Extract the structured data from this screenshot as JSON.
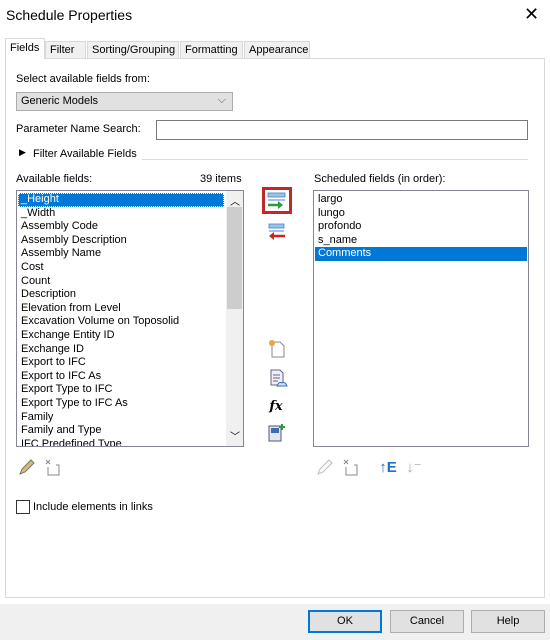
{
  "window": {
    "title": "Schedule Properties"
  },
  "tabs": [
    {
      "label": "Fields"
    },
    {
      "label": "Filter"
    },
    {
      "label": "Sorting/Grouping"
    },
    {
      "label": "Formatting"
    },
    {
      "label": "Appearance"
    }
  ],
  "fields": {
    "select_label": "Select available fields from:",
    "category": "Generic Models",
    "search_label": "Parameter Name Search:",
    "search_value": "",
    "filter_label": "Filter Available Fields",
    "available_label": "Available fields:",
    "count": "39 items",
    "available": [
      "_Height",
      "_Width",
      "Assembly Code",
      "Assembly Description",
      "Assembly Name",
      "Cost",
      "Count",
      "Description",
      "Elevation from Level",
      "Excavation Volume on Toposolid",
      "Exchange Entity ID",
      "Exchange ID",
      "Export to IFC",
      "Export to IFC As",
      "Export Type to IFC",
      "Export Type to IFC As",
      "Family",
      "Family and Type",
      "IFC Predefined Type"
    ],
    "scheduled_label": "Scheduled fields (in order):",
    "scheduled": [
      "largo",
      "lungo",
      "profondo",
      "s_name",
      "Comments"
    ],
    "include_links": "Include elements in links",
    "include_links_checked": false
  },
  "buttons": {
    "ok": "OK",
    "cancel": "Cancel",
    "help": "Help"
  },
  "colors": {
    "selection": "#0078d7",
    "highlight_border": "#c0282a"
  }
}
